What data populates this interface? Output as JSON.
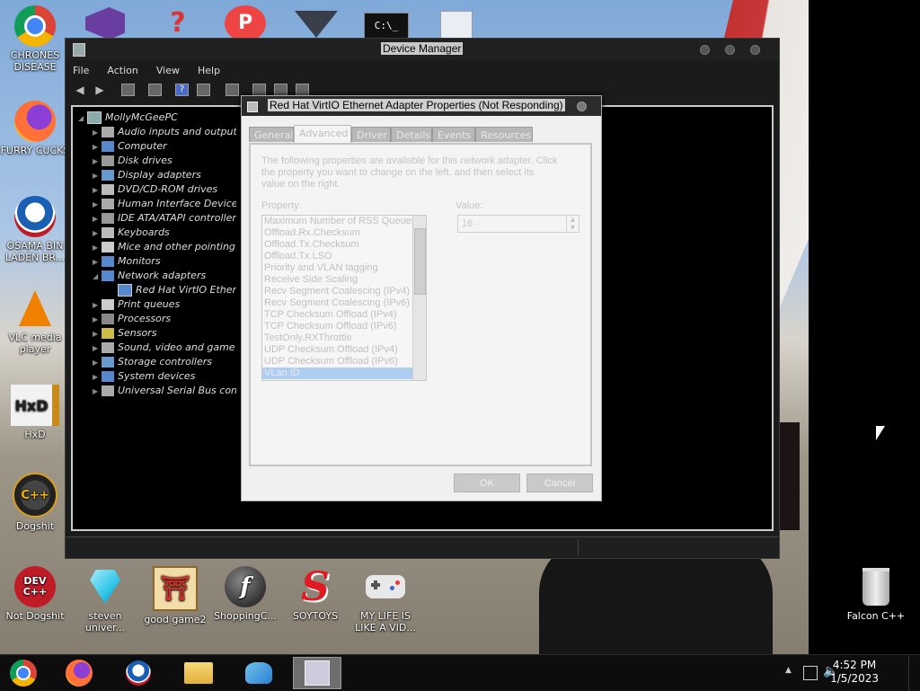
{
  "desktop": {
    "icons": [
      {
        "label": "CHRONES DISEASE",
        "icon": "chrome-icon",
        "color": "#4285f4"
      },
      {
        "label": "FURRY CUCKS",
        "icon": "firefox-icon",
        "color": "#ff7139"
      },
      {
        "label": "OSAMA BIN LADEN BR...",
        "icon": "obama-logo-icon",
        "color": "#1a5fb4"
      },
      {
        "label": "VLC media player",
        "icon": "vlc-cone-icon",
        "color": "#f08000"
      },
      {
        "label": "HxD",
        "icon": "hxd-icon",
        "color": "#c98a1a"
      },
      {
        "label": "Dogshit",
        "icon": "cpp-icon",
        "color": "#333333"
      },
      {
        "label": "Not Dogshit",
        "icon": "devcpp-icon",
        "color": "#c01c28"
      },
      {
        "label": "steven univer...",
        "icon": "gem-icon",
        "color": "#2ec5e8"
      },
      {
        "label": "good game2",
        "icon": "torii-gate-icon",
        "color": "#c8342c"
      },
      {
        "label": "ShoppingC...",
        "icon": "flash-icon",
        "color": "#444444"
      },
      {
        "label": "SOYTOYS",
        "icon": "s-logo-icon",
        "color": "#e01b24"
      },
      {
        "label": "MY LIFE IS LIKE A VID...",
        "icon": "gamepad-icon",
        "color": "#e8e8e8"
      },
      {
        "label": "Falcon C++",
        "icon": "recycle-bin-icon",
        "color": "#cccccc"
      }
    ]
  },
  "device_manager": {
    "title": "Device Manager",
    "menu": [
      "File",
      "Action",
      "View",
      "Help"
    ],
    "tree": {
      "root": "MollyMcGeePC",
      "items": [
        "Audio inputs and outputs",
        "Computer",
        "Disk drives",
        "Display adapters",
        "DVD/CD-ROM drives",
        "Human Interface Devices",
        "IDE ATA/ATAPI controllers",
        "Keyboards",
        "Mice and other pointing devices",
        "Monitors",
        "Network adapters",
        "Red Hat VirtIO Ethernet Adapter",
        "Print queues",
        "Processors",
        "Sensors",
        "Sound, video and game controllers",
        "Storage controllers",
        "System devices",
        "Universal Serial Bus controllers"
      ]
    }
  },
  "properties_dialog": {
    "title": "Red Hat VirtIO Ethernet Adapter Properties (Not Responding)",
    "tabs": [
      "General",
      "Advanced",
      "Driver",
      "Details",
      "Events",
      "Resources"
    ],
    "active_tab": "Advanced",
    "description": "The following properties are available for this network adapter. Click the property you want to change on the left, and then select its value on the right.",
    "property_label": "Property:",
    "value_label": "Value:",
    "properties": [
      "Maximum Number of RSS Queues",
      "Offload.Rx.Checksum",
      "Offload.Tx.Checksum",
      "Offload.Tx.LSO",
      "Priority and VLAN tagging",
      "Receive Side Scaling",
      "Recv Segment Coalescing (IPv4)",
      "Recv Segment Coalescing (IPv6)",
      "TCP Checksum Offload (IPv4)",
      "TCP Checksum Offload (IPv6)",
      "TestOnly.RXThrottle",
      "UDP Checksum Offload (IPv4)",
      "UDP Checksum Offload (IPv6)",
      "VLan ID"
    ],
    "selected_property": "VLan ID",
    "value": "16",
    "ok_label": "OK",
    "cancel_label": "Cancel"
  },
  "taskbar": {
    "items": [
      "chrome-icon",
      "firefox-icon",
      "obama-logo-icon",
      "file-explorer-icon",
      "network-users-icon",
      "device-manager-icon"
    ],
    "clock_time": "4:52 PM",
    "clock_date": "1/5/2023"
  }
}
